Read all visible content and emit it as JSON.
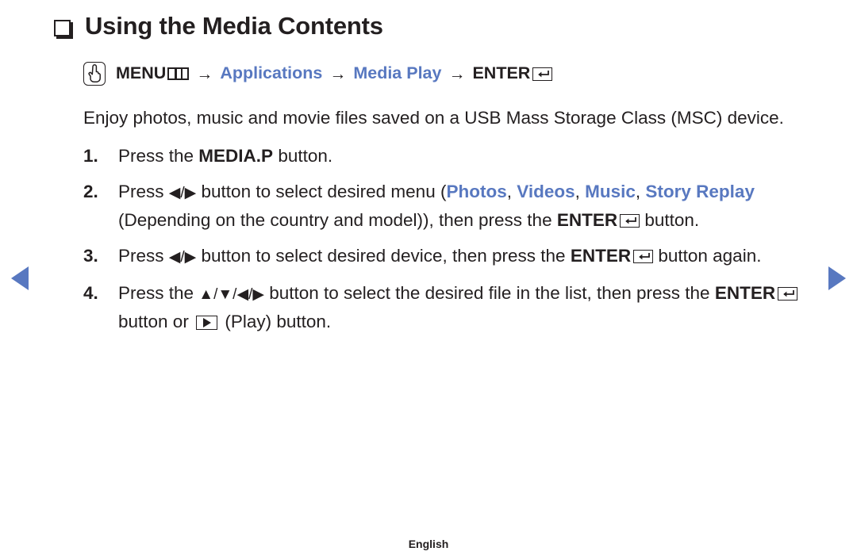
{
  "page": {
    "title": "Using the Media Contents",
    "title_bullet_icon": "square-bullet-icon",
    "footer": "English"
  },
  "nav": {
    "prev_icon": "triangle-left-icon",
    "next_icon": "triangle-right-icon",
    "accent_color": "#5878c0"
  },
  "menu_path": {
    "hand_icon": "hand-pointer-icon",
    "menu_label": "MENU",
    "menu_icon": "menu-keycap-icon",
    "arrow1": "→",
    "applications": "Applications",
    "arrow2": "→",
    "media_play": "Media Play",
    "arrow3": "→",
    "enter_label": "ENTER",
    "enter_icon": "enter-keycap-icon"
  },
  "intro": "Enjoy photos, music and movie files saved on a USB Mass Storage Class (MSC) device.",
  "steps": [
    {
      "num": "1.",
      "parts": [
        {
          "t": "text",
          "v": "Press the "
        },
        {
          "t": "bold",
          "v": "MEDIA.P"
        },
        {
          "t": "text",
          "v": " button."
        }
      ]
    },
    {
      "num": "2.",
      "parts": [
        {
          "t": "text",
          "v": "Press "
        },
        {
          "t": "tri",
          "v": "◀/▶"
        },
        {
          "t": "text",
          "v": " button to select desired menu ("
        },
        {
          "t": "blue",
          "v": "Photos"
        },
        {
          "t": "text",
          "v": ", "
        },
        {
          "t": "blue",
          "v": "Videos"
        },
        {
          "t": "text",
          "v": ", "
        },
        {
          "t": "blue",
          "v": "Music"
        },
        {
          "t": "text",
          "v": ", "
        },
        {
          "t": "blue",
          "v": "Story Replay"
        },
        {
          "t": "text",
          "v": " (Depending on the country and model)), then press the "
        },
        {
          "t": "bold",
          "v": "ENTER"
        },
        {
          "t": "enter-icon",
          "v": ""
        },
        {
          "t": "text",
          "v": " button."
        }
      ]
    },
    {
      "num": "3.",
      "parts": [
        {
          "t": "text",
          "v": "Press "
        },
        {
          "t": "tri",
          "v": "◀/▶"
        },
        {
          "t": "text",
          "v": " button to select desired device, then press the "
        },
        {
          "t": "bold",
          "v": "ENTER"
        },
        {
          "t": "enter-icon",
          "v": ""
        },
        {
          "t": "text",
          "v": " button again."
        }
      ]
    },
    {
      "num": "4.",
      "parts": [
        {
          "t": "text",
          "v": "Press the "
        },
        {
          "t": "tri",
          "v": "▲/▼/◀/▶"
        },
        {
          "t": "text",
          "v": " button to select the desired file in the list, then press the "
        },
        {
          "t": "bold",
          "v": "ENTER"
        },
        {
          "t": "enter-icon",
          "v": ""
        },
        {
          "t": "text",
          "v": " button or "
        },
        {
          "t": "play-icon",
          "v": ""
        },
        {
          "t": "text",
          "v": " (Play) button."
        }
      ]
    }
  ]
}
